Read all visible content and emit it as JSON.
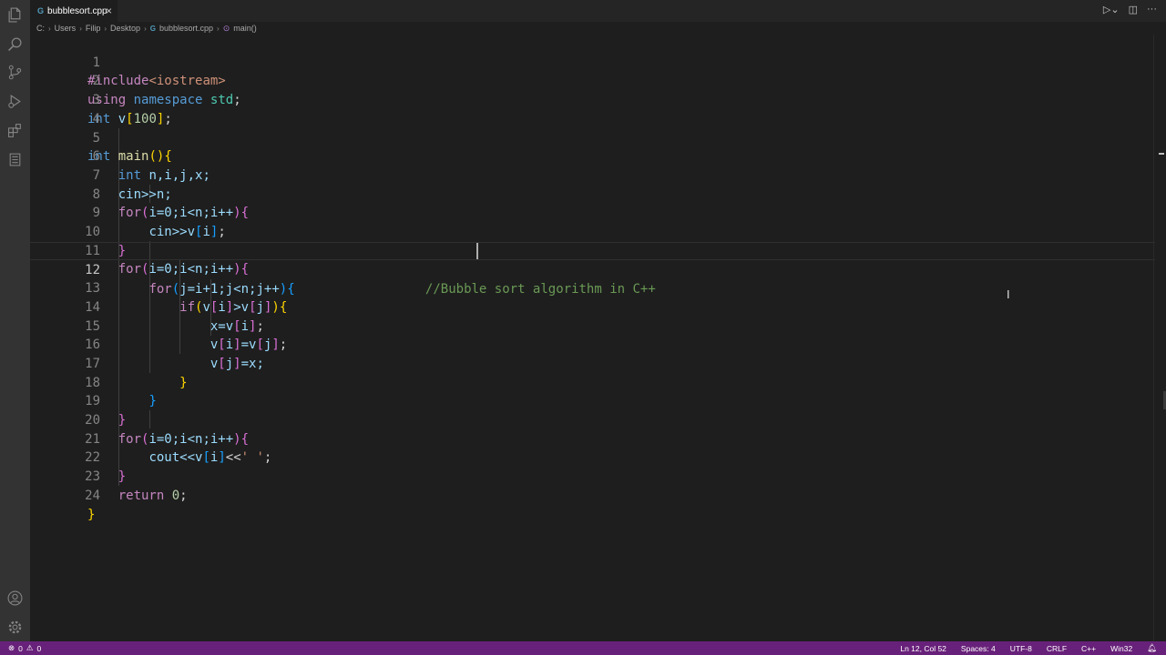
{
  "tab": {
    "filename": "bubblesort.cpp",
    "file_icon": "cpp-icon",
    "close": "×"
  },
  "breadcrumb": [
    "C:",
    "Users",
    "Filip",
    "Desktop",
    "bubblesort.cpp",
    "main()"
  ],
  "editor": {
    "current_line": 12,
    "lines": [
      {
        "n": "1"
      },
      {
        "n": "2"
      },
      {
        "n": "3"
      },
      {
        "n": "4"
      },
      {
        "n": "5"
      },
      {
        "n": "6"
      },
      {
        "n": "7"
      },
      {
        "n": "8"
      },
      {
        "n": "9"
      },
      {
        "n": "10"
      },
      {
        "n": "11"
      },
      {
        "n": "12"
      },
      {
        "n": "13"
      },
      {
        "n": "14"
      },
      {
        "n": "15"
      },
      {
        "n": "16"
      },
      {
        "n": "17"
      },
      {
        "n": "18"
      },
      {
        "n": "19"
      },
      {
        "n": "20"
      },
      {
        "n": "21"
      },
      {
        "n": "22"
      },
      {
        "n": "23"
      },
      {
        "n": "24"
      }
    ],
    "code": {
      "l1_directive": "#include",
      "l1_header": "<iostream>",
      "l2_using": "using",
      "l2_namespace": "namespace",
      "l2_std": "std",
      "l2_semi": ";",
      "l3_int": "int",
      "l3_v": " v",
      "l3_lb": "[",
      "l3_num": "100",
      "l3_rb": "]",
      "l3_semi": ";",
      "l5_int": "int",
      "l5_main": " main",
      "l5_paren": "()",
      "l5_brace": "{",
      "l6_int": "int",
      "l6_vars": " n,i,j,x;",
      "l7_text": "cin>>n;",
      "l8_for": "for",
      "l8_open": "(",
      "l8_body": "i=0;i<n;i++",
      "l8_close": ")",
      "l8_brace": "{",
      "l9_text": "cin>>v",
      "l9_lb": "[",
      "l9_i": "i",
      "l9_rb": "]",
      "l9_semi": ";",
      "l10_brace": "}",
      "l11_for": "for",
      "l11_open": "(",
      "l11_body": "i=0;i<n;i++",
      "l11_close": ")",
      "l11_brace": "{",
      "l12_for": "for",
      "l12_open": "(",
      "l12_body": "j=i+1;j<n;j++",
      "l12_close": ")",
      "l12_brace": "{",
      "l12_comment": "//Bubble sort algorithm in C++",
      "l13_if": "if",
      "l13_open": "(",
      "l13_v1": "v",
      "l13_lb1": "[",
      "l13_i": "i",
      "l13_rb1": "]",
      "l13_gt": ">v",
      "l13_lb2": "[",
      "l13_j": "j",
      "l13_rb2": "]",
      "l13_close": ")",
      "l13_brace": "{",
      "l14_text": "x=v",
      "l14_lb": "[",
      "l14_i": "i",
      "l14_rb": "]",
      "l14_semi": ";",
      "l15_v": "v",
      "l15_lb1": "[",
      "l15_i": "i",
      "l15_rb1": "]",
      "l15_eq": "=v",
      "l15_lb2": "[",
      "l15_j": "j",
      "l15_rb2": "]",
      "l15_semi": ";",
      "l16_v": "v",
      "l16_lb": "[",
      "l16_j": "j",
      "l16_rb": "]",
      "l16_rest": "=x;",
      "l17_brace": "}",
      "l18_brace": "}",
      "l19_brace": "}",
      "l20_for": "for",
      "l20_open": "(",
      "l20_body": "i=0;i<n;i++",
      "l20_close": ")",
      "l20_brace": "{",
      "l21_text": "cout<<v",
      "l21_lb": "[",
      "l21_i": "i",
      "l21_rb": "]",
      "l21_op": "<<",
      "l21_str": "' '",
      "l21_semi": ";",
      "l22_brace": "}",
      "l23_return": "return",
      "l23_num": " 0",
      "l23_semi": ";",
      "l24_brace": "}"
    }
  },
  "statusbar": {
    "errors": "0",
    "warnings": "0",
    "position": "Ln 12, Col 52",
    "spaces": "Spaces: 4",
    "encoding": "UTF-8",
    "eol": "CRLF",
    "language": "C++",
    "platform": "Win32"
  },
  "colors": {
    "statusbar": "#68217a",
    "editor_bg": "#1e1e1e",
    "activity_bar": "#333333"
  }
}
